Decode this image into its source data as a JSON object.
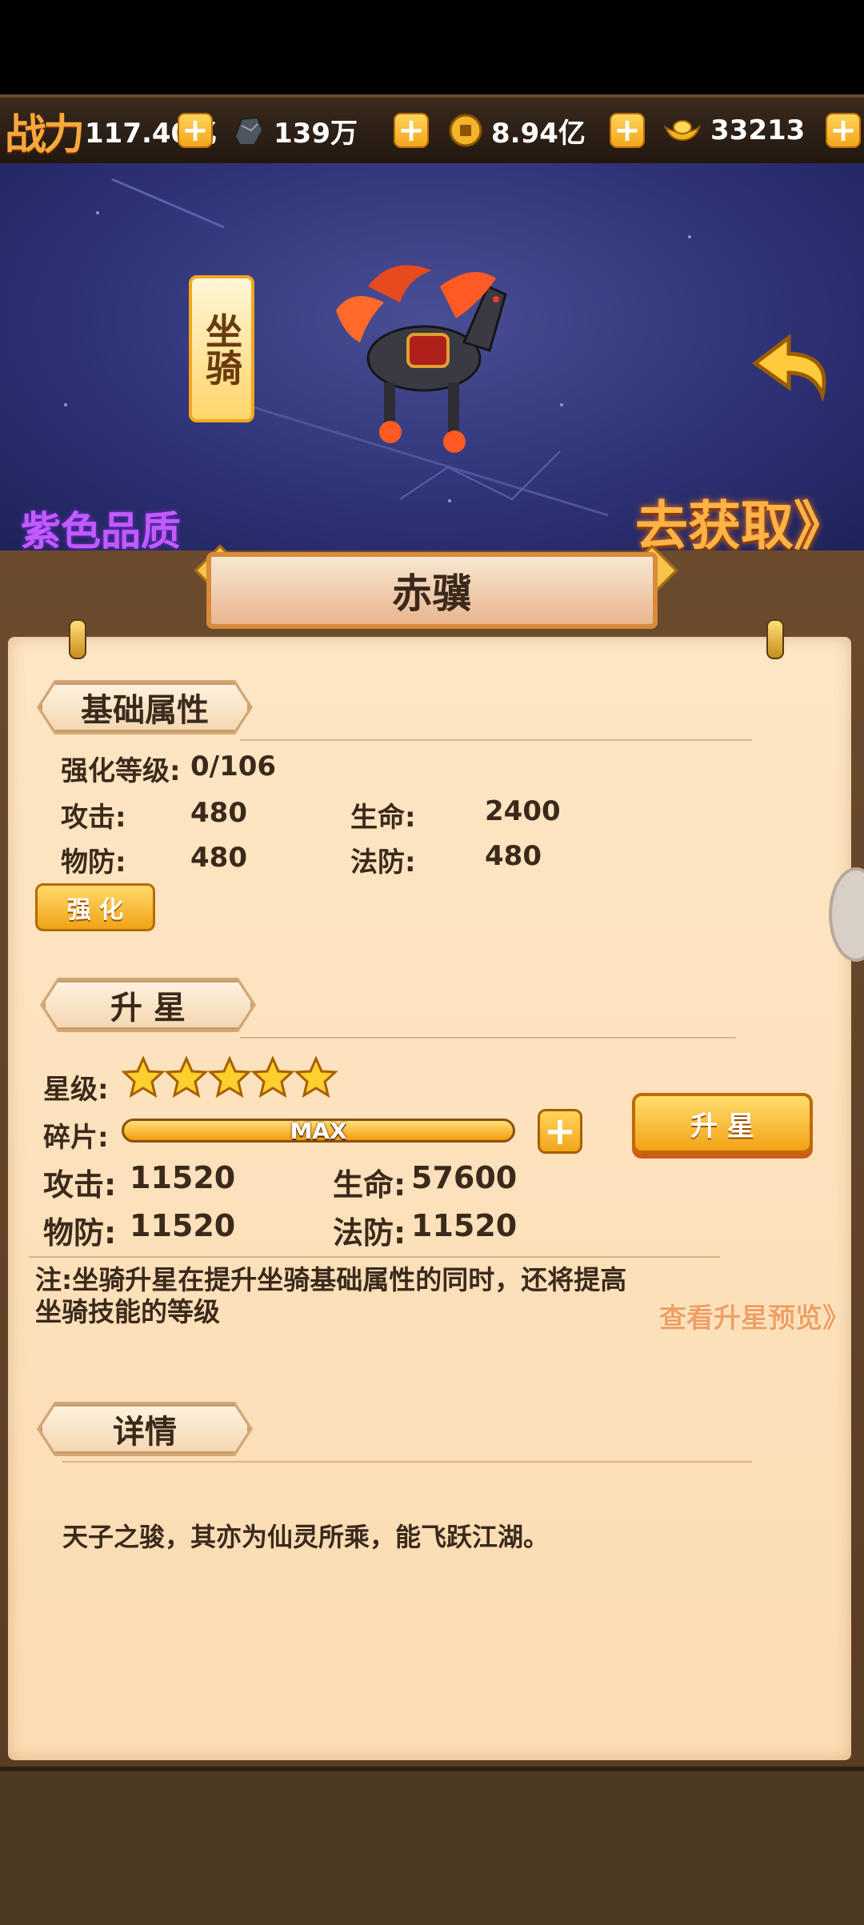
{
  "topbar": {
    "power_label": "战力",
    "power_value": "117.40亿",
    "ore_value": "139万",
    "coin_value": "8.94亿",
    "ingot_value": "33213",
    "plus_symbol": "+"
  },
  "banner": {
    "type_tag": "坐骑",
    "quality": "紫色品质",
    "get_link": "去获取》"
  },
  "mount_name": "赤骥",
  "base_attrs": {
    "header": "基础属性",
    "level_label": "强化等级:",
    "level_value": "0/106",
    "attack_label": "攻击:",
    "attack_value": "480",
    "hp_label": "生命:",
    "hp_value": "2400",
    "pdef_label": "物防:",
    "pdef_value": "480",
    "mdef_label": "法防:",
    "mdef_value": "480",
    "enhance_button": "强 化"
  },
  "star_up": {
    "header": "升  星",
    "star_label": "星级:",
    "stars": 5,
    "shard_label": "碎片:",
    "shard_bar_text": "MAX",
    "shard_fill": 1.0,
    "attack_label": "攻击:",
    "attack_value": "11520",
    "hp_label": "生命:",
    "hp_value": "57600",
    "pdef_label": "物防:",
    "pdef_value": "11520",
    "mdef_label": "法防:",
    "mdef_value": "11520",
    "button": "升 星",
    "note": "注:坐骑升星在提升坐骑基础属性的同时，还将提高坐骑技能的等级",
    "preview_link": "查看升星预览》"
  },
  "details": {
    "header": "详情",
    "text": "天子之骏，其亦为仙灵所乘，能飞跃江湖。"
  },
  "colors": {
    "accent": "#f3a51a",
    "quality_purple": "#c25cff",
    "text_dark": "#3b2a1c"
  }
}
